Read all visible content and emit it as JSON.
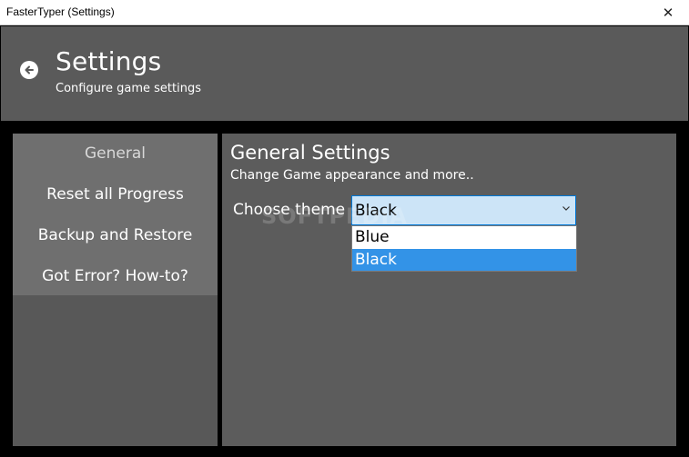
{
  "window": {
    "title": "FasterTyper (Settings)",
    "close_glyph": "✕"
  },
  "header": {
    "title": "Settings",
    "subtitle": "Configure game settings",
    "back_icon": "back-arrow-circle-icon"
  },
  "sidebar": {
    "items": [
      {
        "label": "General",
        "active": true
      },
      {
        "label": "Reset all Progress",
        "active": false
      },
      {
        "label": "Backup and Restore",
        "active": false
      },
      {
        "label": "Got Error? How-to?",
        "active": false
      }
    ]
  },
  "main": {
    "title": "General Settings",
    "subtitle": "Change Game appearance and more..",
    "theme_label": "Choose theme :",
    "theme_select": {
      "value": "Black",
      "options": [
        "Blue",
        "Black"
      ],
      "selected_index": 1
    }
  },
  "watermark": "SOFTPEDIA",
  "colors": {
    "header_bg": "#5a5a5a",
    "sidebar_bg": "#585858",
    "sidebar_items_bg": "#6f6f6f",
    "main_bg": "#5c5c5c",
    "select_bg": "#cce4f7",
    "accent": "#0078d7",
    "option_selected": "#3393e7"
  }
}
